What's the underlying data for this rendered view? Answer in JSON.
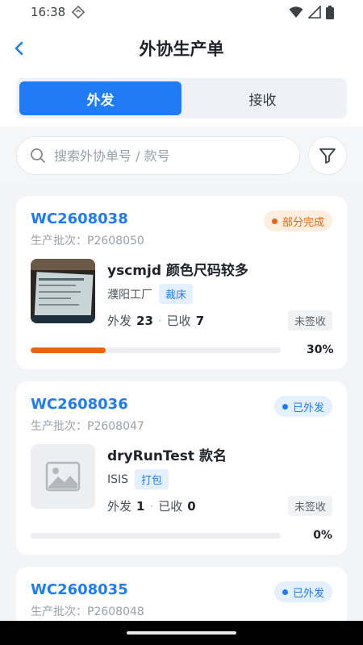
{
  "status": {
    "time": "16:38"
  },
  "header": {
    "title": "外协生产单"
  },
  "tabs": [
    {
      "label": "外发",
      "active": true
    },
    {
      "label": "接收",
      "active": false
    }
  ],
  "search": {
    "placeholder": "搜索外协单号 / 款号",
    "value": ""
  },
  "colors": {
    "accent": "#1f7cf6",
    "orange": "#e8650f"
  },
  "orders": [
    {
      "order_no": "WC2608038",
      "batch": "生产批次：P2608050",
      "status": "部分完成",
      "status_color": "orange",
      "image": "photo-thumbnail",
      "name": "yscmjd 颜色尺码较多",
      "factory": "濮阳工厂",
      "process": "裁床",
      "out_label": "外发",
      "out_qty": "23",
      "recv_label": "已收",
      "recv_qty": "7",
      "sign": "未签收",
      "progress": 30,
      "progress_text": "30%"
    },
    {
      "order_no": "WC2608036",
      "batch": "生产批次：P2608047",
      "status": "已外发",
      "status_color": "blue",
      "image": "image-placeholder-icon",
      "name": "dryRunTest 款名",
      "factory": "ISIS",
      "process": "打包",
      "out_label": "外发",
      "out_qty": "1",
      "recv_label": "已收",
      "recv_qty": "0",
      "sign": "未签收",
      "progress": 0,
      "progress_text": "0%"
    },
    {
      "order_no": "WC2608035",
      "batch": "生产批次：P2608048",
      "status": "已外发",
      "status_color": "blue"
    }
  ]
}
